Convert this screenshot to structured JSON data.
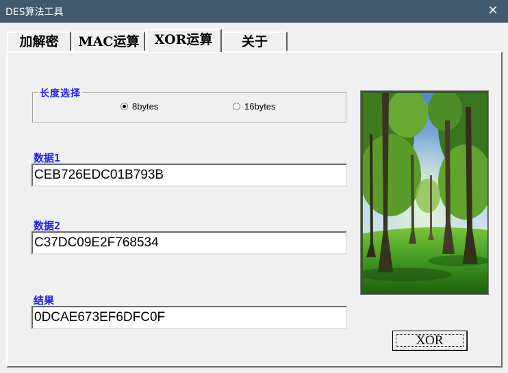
{
  "window": {
    "title": "DES算法工具",
    "close_label": "✕"
  },
  "tabs": [
    {
      "label": "加解密",
      "active": false
    },
    {
      "label": "MAC运算",
      "active": false
    },
    {
      "label": "XOR运算",
      "active": true
    },
    {
      "label": "关于",
      "active": false
    }
  ],
  "length_group": {
    "label": "长度选择",
    "options": [
      {
        "label": "8bytes",
        "selected": true
      },
      {
        "label": "16bytes",
        "selected": false
      }
    ]
  },
  "fields": {
    "data1": {
      "label": "数据1",
      "value": "CEB726EDC01B793B"
    },
    "data2": {
      "label": "数据2",
      "value": "C37DC09E2F768534"
    },
    "result": {
      "label": "结果",
      "value": "0DCAE673EF6DFC0F"
    }
  },
  "xor_button": {
    "label": "XOR"
  },
  "colors": {
    "titlebar": "#415a6e",
    "label_blue": "#1c1cf5",
    "dialog_bg": "#f0f0f0"
  }
}
